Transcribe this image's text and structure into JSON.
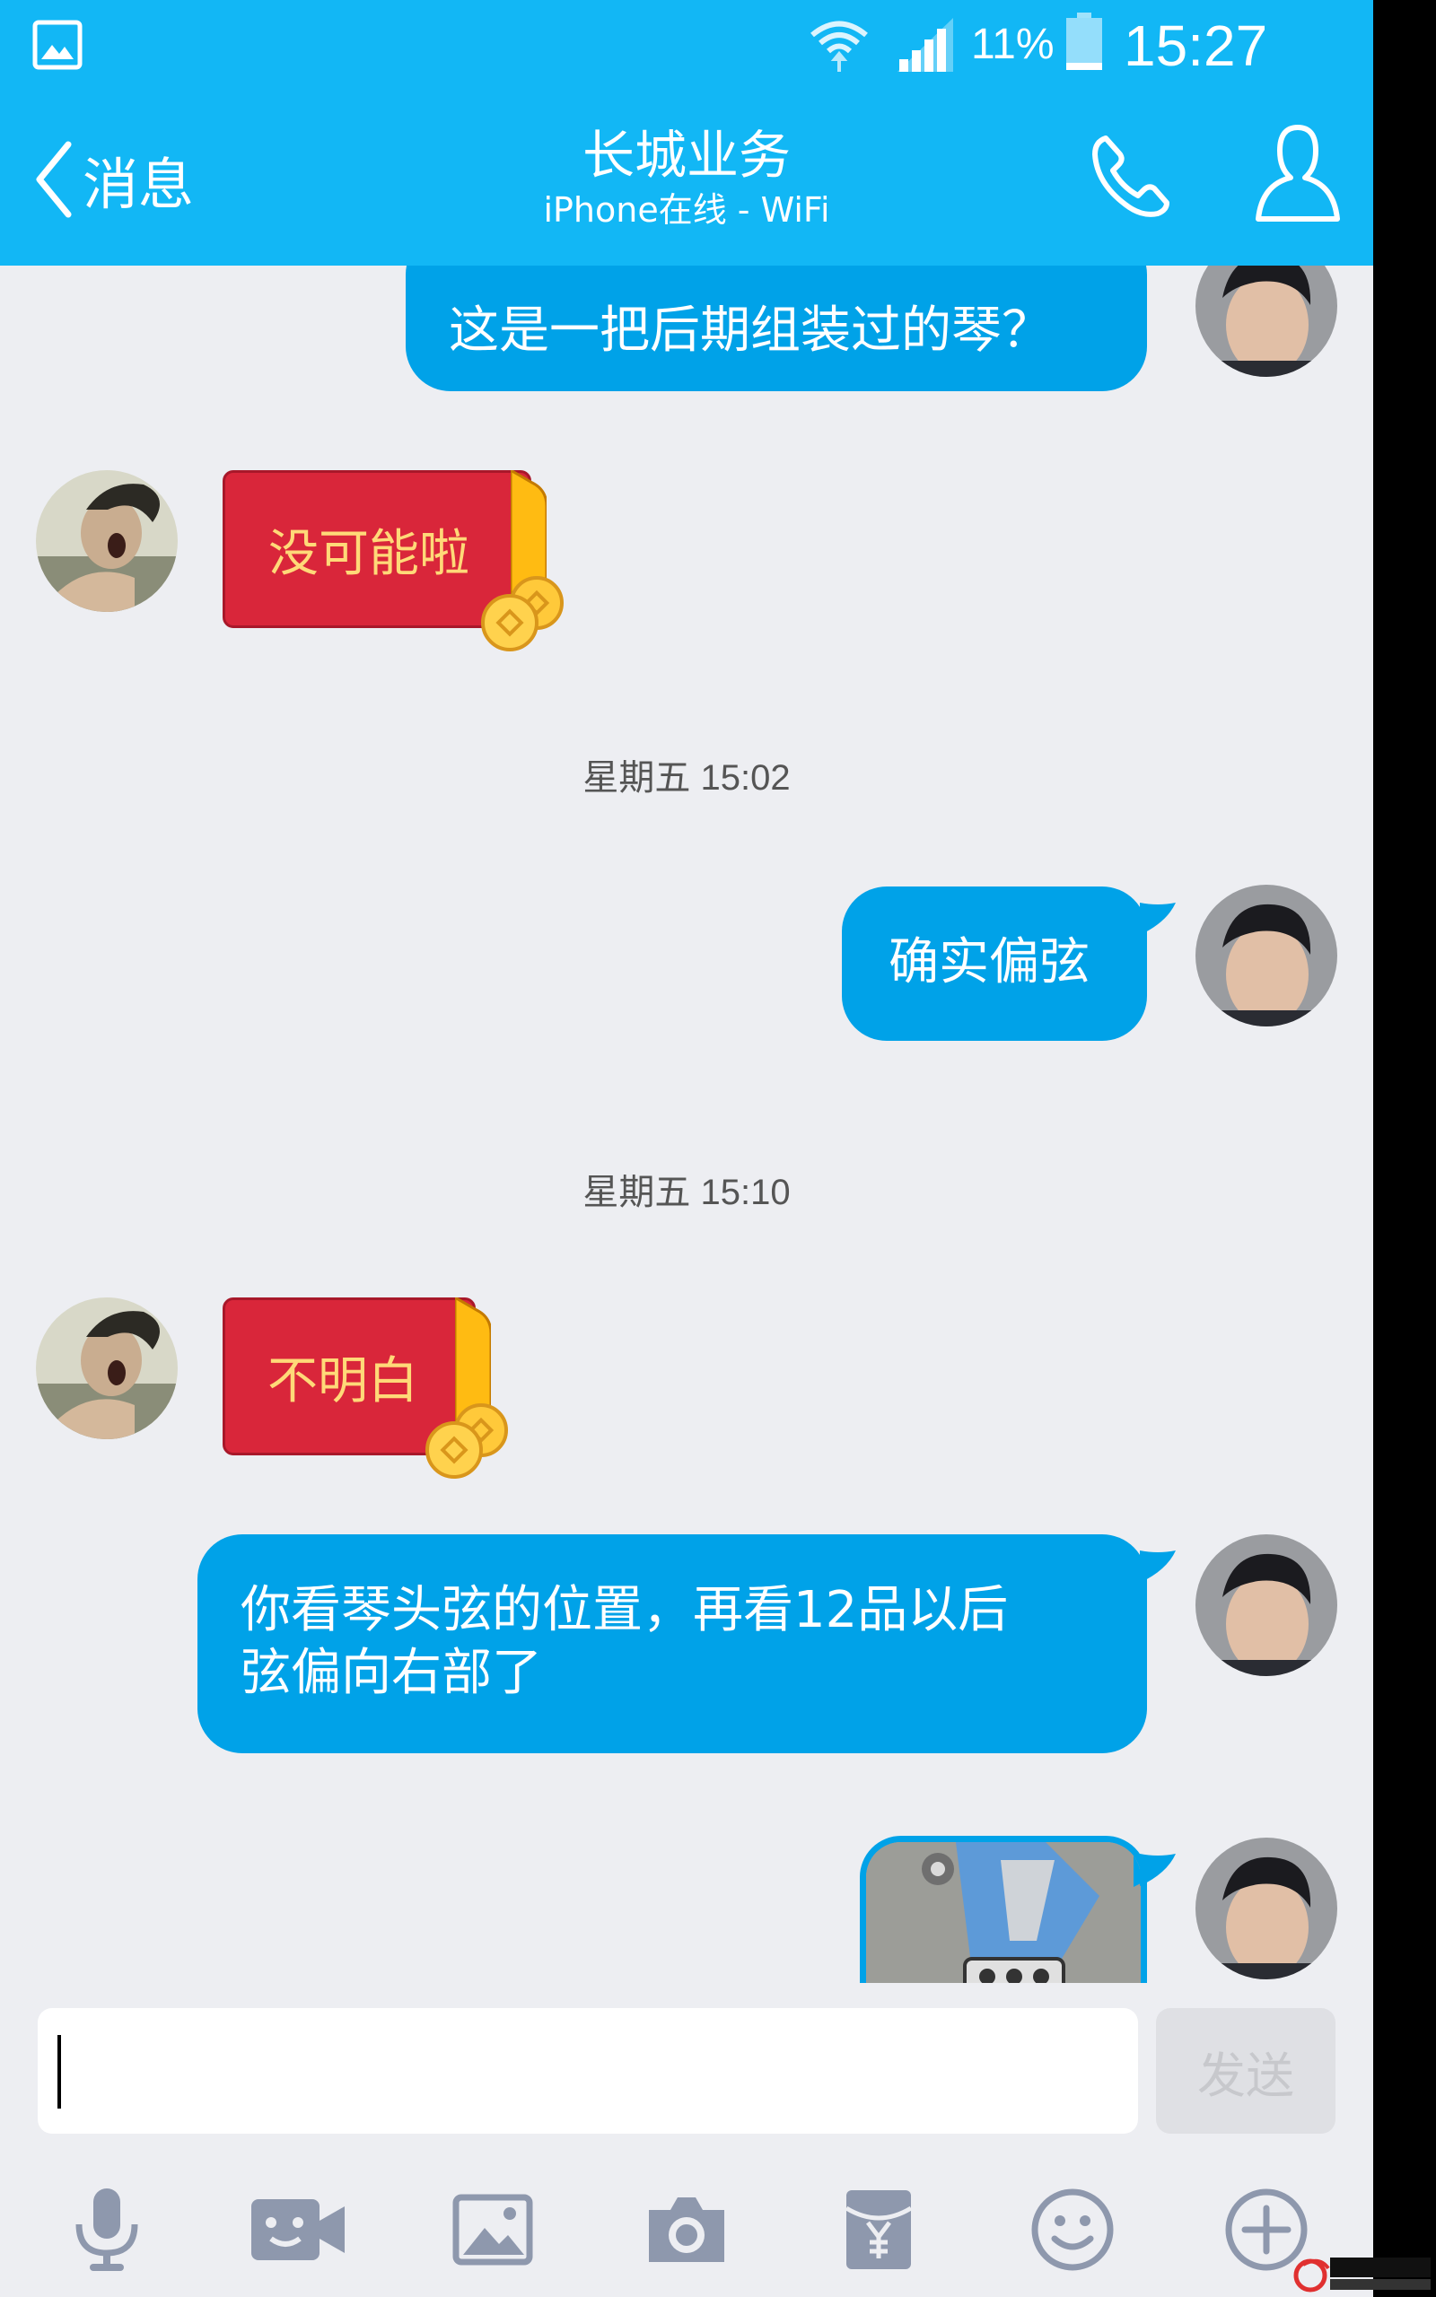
{
  "status_bar": {
    "battery_percent": "11%",
    "time": "15:27"
  },
  "header": {
    "back_label": "消息",
    "title": "长城业务",
    "subtitle": "iPhone在线 - WiFi"
  },
  "messages": [
    {
      "side": "out",
      "type": "text",
      "text": "这是一把后期组装过的琴？"
    },
    {
      "side": "in",
      "type": "red_packet",
      "text": "没可能啦"
    },
    {
      "type": "timestamp",
      "text": "星期五 15:02"
    },
    {
      "side": "out",
      "type": "text",
      "text": "确实偏弦"
    },
    {
      "type": "timestamp",
      "text": "星期五 15:10"
    },
    {
      "side": "in",
      "type": "red_packet",
      "text": "不明白"
    },
    {
      "side": "out",
      "type": "text",
      "line1": "你看琴头弦的位置，再看12品以后",
      "line2": "弦偏向右部了"
    },
    {
      "side": "out",
      "type": "image"
    }
  ],
  "input": {
    "value": "",
    "send_label": "发送"
  },
  "toolbar": [
    "mic-icon",
    "video-icon",
    "image-icon",
    "camera-icon",
    "red-packet-icon",
    "emoji-icon",
    "plus-icon"
  ],
  "colors": {
    "accent": "#12b7f5",
    "bubble": "#00a2e8",
    "red_packet": "#d9263a"
  }
}
